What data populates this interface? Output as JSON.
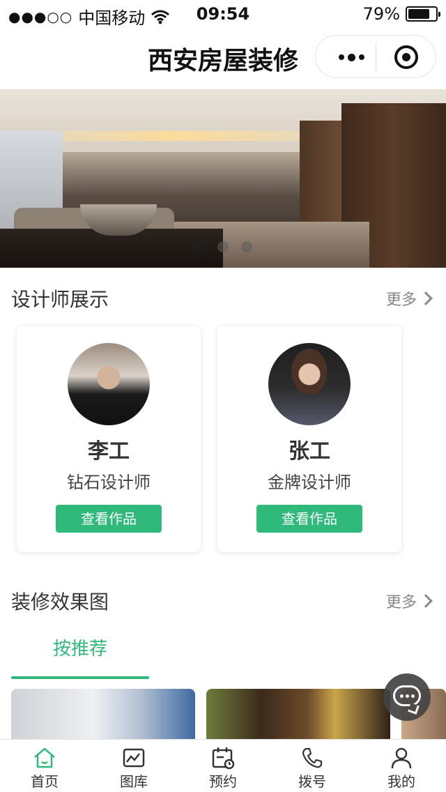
{
  "status_bar": {
    "signal_dots": "●●●○○",
    "carrier": "中国移动",
    "time": "09:54",
    "battery_percent": "79%",
    "battery_level": 0.79
  },
  "title_bar": {
    "title": "西安房屋装修"
  },
  "banner": {
    "slide_count": 3,
    "active_slide": 1
  },
  "designers_section": {
    "title": "设计师展示",
    "more_label": "更多",
    "designers": [
      {
        "name": "李工",
        "role": "钻石设计师",
        "button_label": "查看作品"
      },
      {
        "name": "张工",
        "role": "金牌设计师",
        "button_label": "查看作品"
      }
    ]
  },
  "renderings_section": {
    "title": "装修效果图",
    "more_label": "更多",
    "active_tab": "按推荐"
  },
  "colors": {
    "accent": "#2fba7c"
  },
  "tab_bar": {
    "items": [
      {
        "label": "首页",
        "icon": "home-icon",
        "active": true
      },
      {
        "label": "图库",
        "icon": "gallery-icon",
        "active": false
      },
      {
        "label": "预约",
        "icon": "calendar-icon",
        "active": false
      },
      {
        "label": "拨号",
        "icon": "phone-icon",
        "active": false
      },
      {
        "label": "我的",
        "icon": "user-icon",
        "active": false
      }
    ]
  }
}
